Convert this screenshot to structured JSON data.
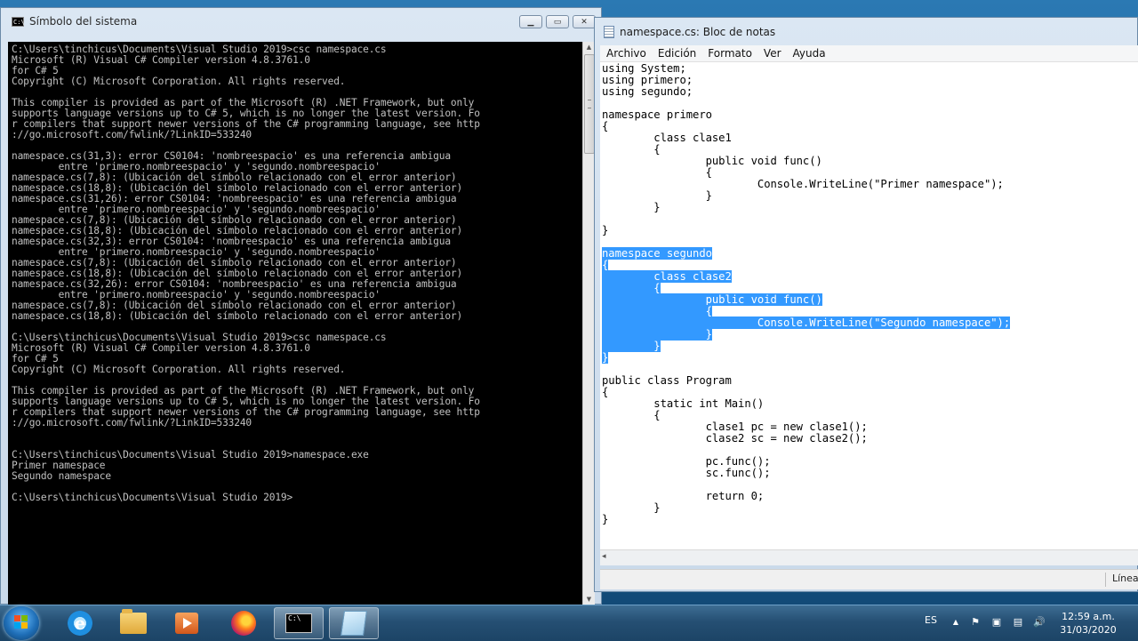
{
  "cmd": {
    "title": "Símbolo del sistema",
    "icon_text": "C:\\",
    "minimize": "▁",
    "maximize": "▭",
    "close": "✕",
    "lines": [
      "C:\\Users\\tinchicus\\Documents\\Visual Studio 2019>csc namespace.cs",
      "Microsoft (R) Visual C# Compiler version 4.8.3761.0",
      "for C# 5",
      "Copyright (C) Microsoft Corporation. All rights reserved.",
      "",
      "This compiler is provided as part of the Microsoft (R) .NET Framework, but only",
      "supports language versions up to C# 5, which is no longer the latest version. Fo",
      "r compilers that support newer versions of the C# programming language, see http",
      "://go.microsoft.com/fwlink/?LinkID=533240",
      "",
      "namespace.cs(31,3): error CS0104: 'nombreespacio' es una referencia ambigua",
      "        entre 'primero.nombreespacio' y 'segundo.nombreespacio'",
      "namespace.cs(7,8): (Ubicación del símbolo relacionado con el error anterior)",
      "namespace.cs(18,8): (Ubicación del símbolo relacionado con el error anterior)",
      "namespace.cs(31,26): error CS0104: 'nombreespacio' es una referencia ambigua",
      "        entre 'primero.nombreespacio' y 'segundo.nombreespacio'",
      "namespace.cs(7,8): (Ubicación del símbolo relacionado con el error anterior)",
      "namespace.cs(18,8): (Ubicación del símbolo relacionado con el error anterior)",
      "namespace.cs(32,3): error CS0104: 'nombreespacio' es una referencia ambigua",
      "        entre 'primero.nombreespacio' y 'segundo.nombreespacio'",
      "namespace.cs(7,8): (Ubicación del símbolo relacionado con el error anterior)",
      "namespace.cs(18,8): (Ubicación del símbolo relacionado con el error anterior)",
      "namespace.cs(32,26): error CS0104: 'nombreespacio' es una referencia ambigua",
      "        entre 'primero.nombreespacio' y 'segundo.nombreespacio'",
      "namespace.cs(7,8): (Ubicación del símbolo relacionado con el error anterior)",
      "namespace.cs(18,8): (Ubicación del símbolo relacionado con el error anterior)",
      "",
      "C:\\Users\\tinchicus\\Documents\\Visual Studio 2019>csc namespace.cs",
      "Microsoft (R) Visual C# Compiler version 4.8.3761.0",
      "for C# 5",
      "Copyright (C) Microsoft Corporation. All rights reserved.",
      "",
      "This compiler is provided as part of the Microsoft (R) .NET Framework, but only",
      "supports language versions up to C# 5, which is no longer the latest version. Fo",
      "r compilers that support newer versions of the C# programming language, see http",
      "://go.microsoft.com/fwlink/?LinkID=533240",
      "",
      "",
      "C:\\Users\\tinchicus\\Documents\\Visual Studio 2019>namespace.exe",
      "Primer namespace",
      "Segundo namespace",
      "",
      "C:\\Users\\tinchicus\\Documents\\Visual Studio 2019>"
    ]
  },
  "notepad": {
    "title": "namespace.cs: Bloc de notas",
    "menu": [
      "Archivo",
      "Edición",
      "Formato",
      "Ver",
      "Ayuda"
    ],
    "code_before": [
      "using System;",
      "using primero;",
      "using segundo;",
      "",
      "namespace primero",
      "{",
      "        class clase1",
      "        {",
      "                public void func()",
      "                {",
      "                        Console.WriteLine(\"Primer namespace\");",
      "                }",
      "        }",
      "",
      "}",
      ""
    ],
    "code_selected": [
      "namespace segundo",
      "{",
      "        class clase2",
      "        {",
      "                public void func()",
      "                {",
      "                        Console.WriteLine(\"Segundo namespace\");",
      "                }",
      "        }",
      "}"
    ],
    "code_after": [
      "",
      "public class Program",
      "{",
      "        static int Main()",
      "        {",
      "                clase1 pc = new clase1();",
      "                clase2 sc = new clase2();",
      "",
      "                pc.func();",
      "                sc.func();",
      "",
      "                return 0;",
      "        }",
      "}"
    ],
    "status": "Línea"
  },
  "taskbar": {
    "language": "ES",
    "time": "12:59 a.m.",
    "date": "31/03/2020",
    "tray_icons": [
      "▲",
      "⚑",
      "▣",
      "▤",
      "🔊"
    ]
  }
}
